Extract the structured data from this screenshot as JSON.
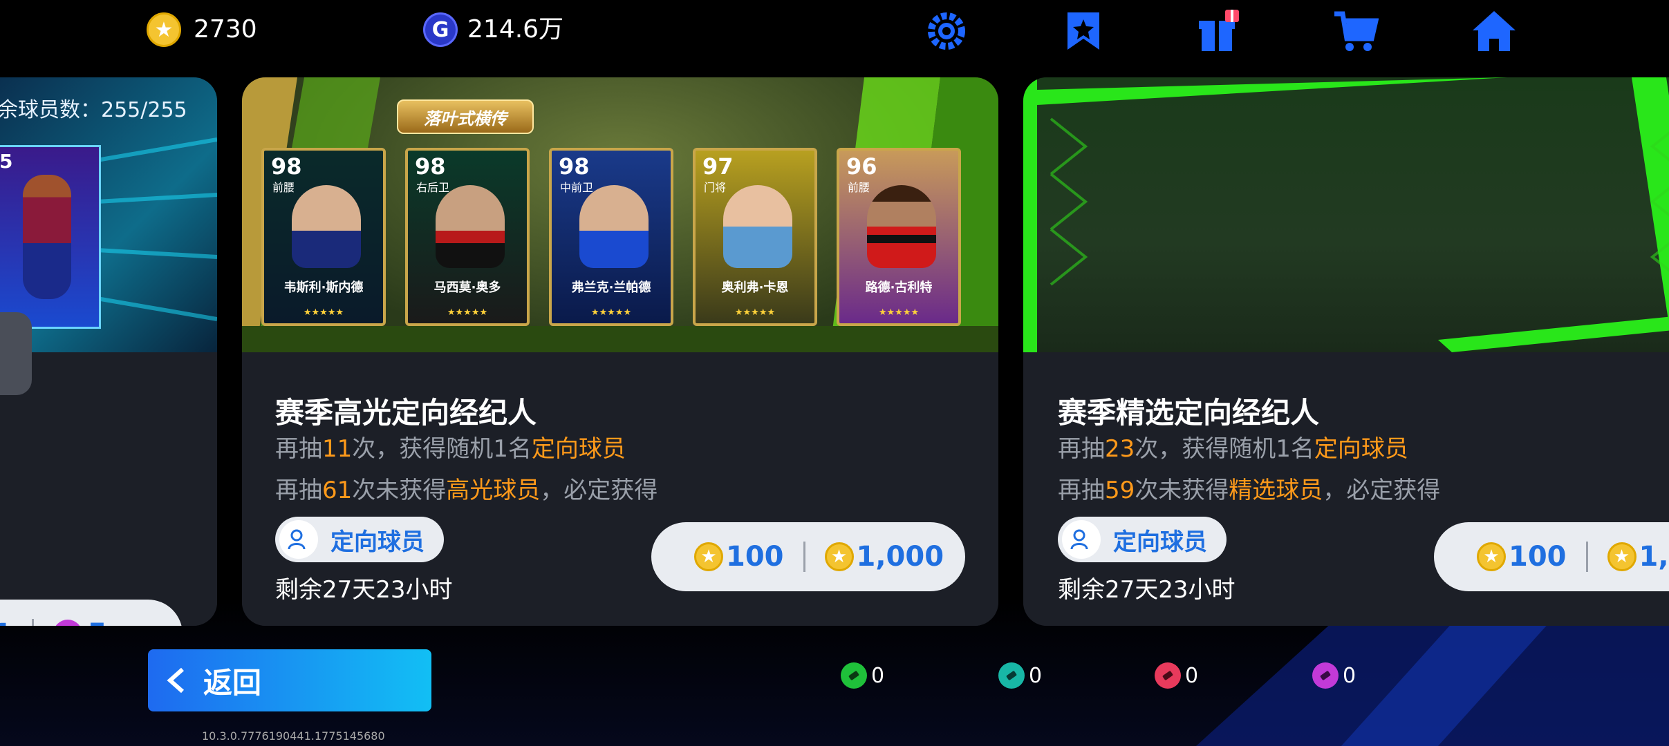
{
  "topbar": {
    "coins": "2730",
    "gp": "214.6万",
    "gp_letter": "G",
    "coin_letter": "★",
    "icons": [
      "settings-gear-icon",
      "bookmark-icon",
      "gift-box-icon",
      "cart-icon",
      "home-icon"
    ]
  },
  "left_card": {
    "remaining_players": "余球员数：255/255",
    "price_ticket": "5",
    "price_first_partial": "1",
    "player_rating": "5"
  },
  "card1": {
    "banner_title": "落叶式横传",
    "title": "赛季高光定向经纪人",
    "line1_pre": "再抽",
    "line1_num": "11",
    "line1_mid": "次，获得随机1名",
    "line1_hl": "定向球员",
    "line2_pre": "再抽",
    "line2_num": "61",
    "line2_mid": "次未获得",
    "line2_hl": "高光球员",
    "line2_post": "，必定获得",
    "tag": "定向球员",
    "remaining": "剩余27天23小时",
    "price1": "100",
    "price2": "1,000",
    "players": [
      {
        "rating": "98",
        "pos": "前腰",
        "name": "韦斯利·斯内德",
        "stars": "★★★★★"
      },
      {
        "rating": "98",
        "pos": "右后卫",
        "name": "马西莫·奥多",
        "stars": "★★★★★"
      },
      {
        "rating": "98",
        "pos": "中前卫",
        "name": "弗兰克·兰帕德",
        "stars": "★★★★★"
      },
      {
        "rating": "97",
        "pos": "门将",
        "name": "奥利弗·卡恩",
        "stars": "★★★★★"
      },
      {
        "rating": "96",
        "pos": "前腰",
        "name": "路德·古利特",
        "stars": "★★★★★"
      }
    ]
  },
  "card2": {
    "title": "赛季精选定向经纪人",
    "line1_pre": "再抽",
    "line1_num": "23",
    "line1_mid": "次，获得随机1名",
    "line1_hl": "定向球员",
    "line2_pre": "再抽",
    "line2_num": "59",
    "line2_mid": "次未获得",
    "line2_hl": "精选球员",
    "line2_post": "，必定获得",
    "tag": "定向球员",
    "remaining": "剩余27天23小时",
    "price1": "100",
    "price2_partial": "1,0"
  },
  "bottom": {
    "back_label": "返回",
    "tickets": [
      {
        "name": "green-ticket-icon",
        "count": "0",
        "color": "#1fc13a"
      },
      {
        "name": "teal-ticket-icon",
        "count": "0",
        "color": "#18b7a6"
      },
      {
        "name": "red-ticket-icon",
        "count": "0",
        "color": "#e83a5c"
      },
      {
        "name": "purple-ticket-icon",
        "count": "0",
        "color": "#c23ad8"
      }
    ],
    "version": "10.3.0.7776190441.1775145680"
  },
  "colors": {
    "accent_blue": "#1f6fe0",
    "highlight_orange": "#ff9a1a",
    "gold": "#f4c430"
  }
}
